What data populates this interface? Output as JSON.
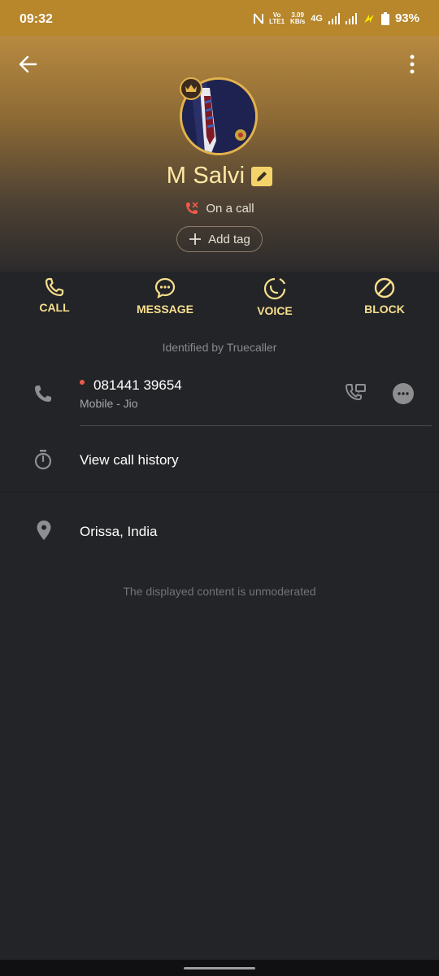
{
  "status_bar": {
    "time": "09:32",
    "volte_line1": "Vo",
    "volte_line2": "LTE1",
    "speed_value": "3.09",
    "speed_unit": "KB/s",
    "network": "4G",
    "battery": "93%"
  },
  "header": {
    "back_icon": "arrow-left-icon",
    "menu_icon": "more-vertical-icon"
  },
  "profile": {
    "name": "M Salvi",
    "status": "On a call",
    "add_tag_label": "Add tag"
  },
  "actions": [
    {
      "label": "CALL",
      "icon": "phone-icon"
    },
    {
      "label": "MESSAGE",
      "icon": "message-icon"
    },
    {
      "label": "VOICE",
      "icon": "voice-icon"
    },
    {
      "label": "BLOCK",
      "icon": "block-icon"
    }
  ],
  "identified_text": "Identified by Truecaller",
  "phone": {
    "number": "081441 39654",
    "type": "Mobile - Jio"
  },
  "history_label": "View call history",
  "location_label": "Orissa, India",
  "footnote": "The displayed content is unmoderated",
  "colors": {
    "accent_gold": "#f8df8e",
    "status_bar": "#b8862b",
    "background": "#232427",
    "call_red": "#f05a4a"
  }
}
